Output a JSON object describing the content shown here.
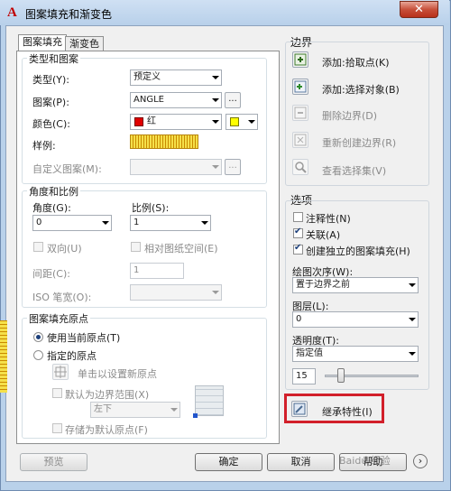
{
  "window": {
    "title": "图案填充和渐变色",
    "close": "✕"
  },
  "tabs": [
    {
      "label": "图案填充"
    },
    {
      "label": "渐变色"
    }
  ],
  "type_pattern": {
    "title": "类型和图案",
    "type_label": "类型(Y):",
    "type_value": "预定义",
    "pattern_label": "图案(P):",
    "pattern_value": "ANGLE",
    "color_label": "颜色(C):",
    "color_value": "红",
    "sample_label": "样例:",
    "custom_label": "自定义图案(M):",
    "dots": "...",
    "colors": {
      "red": "#e00000",
      "yellow": "#ffff00"
    }
  },
  "angle_scale": {
    "title": "角度和比例",
    "angle_label": "角度(G):",
    "angle_value": "0",
    "scale_label": "比例(S):",
    "scale_value": "1",
    "double_label": "双向(U)",
    "relative_label": "相对图纸空间(E)",
    "spacing_label": "间距(C):",
    "spacing_value": "1",
    "iso_label": "ISO 笔宽(O):"
  },
  "origin": {
    "title": "图案填充原点",
    "use_current": "使用当前原点(T)",
    "specified": "指定的原点",
    "click_set": "单击以设置新原点",
    "default_extent": "默认为边界范围(X)",
    "extent_value": "左下",
    "store_default": "存储为默认原点(F)"
  },
  "boundary": {
    "title": "边界",
    "add_pick": "添加:拾取点(K)",
    "add_select": "添加:选择对象(B)",
    "remove": "删除边界(D)",
    "recreate": "重新创建边界(R)",
    "view": "查看选择集(V)"
  },
  "options": {
    "title": "选项",
    "annotative": "注释性(N)",
    "associative": "关联(A)",
    "separate": "创建独立的图案填充(H)",
    "draw_order_label": "绘图次序(W):",
    "draw_order_value": "置于边界之前",
    "layer_label": "图层(L):",
    "layer_value": "0",
    "transparency_label": "透明度(T):",
    "transparency_value": "指定值",
    "transparency_number": "15"
  },
  "inherit": {
    "label": "继承特性(I)"
  },
  "footer": {
    "preview": "预览",
    "ok": "确定",
    "cancel": "取消",
    "help": "帮助",
    "expand": "›"
  },
  "watermark": "Baidu 经验"
}
